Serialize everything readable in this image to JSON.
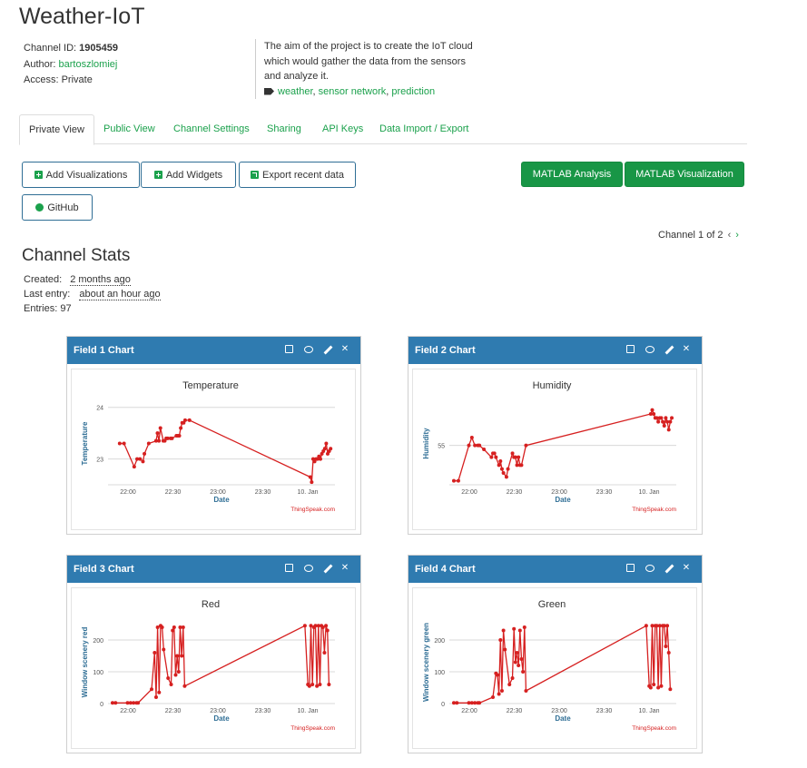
{
  "title": "Weather-IoT",
  "channel": {
    "id_label": "Channel ID:",
    "id_value": "1905459",
    "author_label": "Author:",
    "author_value": "bartoszlomiej",
    "access_label": "Access:",
    "access_value": "Private",
    "description": "The aim of the project is to create the IoT cloud which would gather the data from the sensors and analyze it.",
    "tags": [
      "weather",
      "sensor network",
      "prediction"
    ]
  },
  "tabs": [
    "Private View",
    "Public View",
    "Channel Settings",
    "Sharing",
    "API Keys",
    "Data Import / Export"
  ],
  "buttons": {
    "add_visualizations": "Add Visualizations",
    "add_widgets": "Add Widgets",
    "export": "Export recent data",
    "github": "GitHub",
    "matlab_analysis": "MATLAB Analysis",
    "matlab_visualization": "MATLAB Visualization"
  },
  "pager": {
    "label": "Channel 1 of 2",
    "prev": "‹",
    "next": "›"
  },
  "stats": {
    "title": "Channel Stats",
    "created_label": "Created:",
    "created_value": "2 months ago",
    "last_label": "Last entry:",
    "last_value": "about an hour ago",
    "entries_label": "Entries:",
    "entries_value": "97"
  },
  "colors": {
    "accent": "#1ba14c",
    "panel_header": "#2f7bb0",
    "series": "#d62020",
    "matlab": "#189646"
  },
  "panels": [
    {
      "header": "Field 1 Chart"
    },
    {
      "header": "Field 2 Chart"
    },
    {
      "header": "Field 3 Chart"
    },
    {
      "header": "Field 4 Chart"
    }
  ],
  "credit": "ThingSpeak.com",
  "chart_data": [
    {
      "type": "line",
      "title": "Temperature",
      "xlabel": "Date",
      "ylabel": "Temperature",
      "xticks": [
        "22:00",
        "22:30",
        "23:00",
        "23:30",
        "10. Jan"
      ],
      "yticks": [
        23,
        24
      ],
      "ylim": [
        22.5,
        24.1
      ],
      "x": [
        0,
        3,
        10,
        12,
        14,
        16,
        17,
        20,
        25,
        26,
        27,
        28,
        30,
        31,
        32,
        33,
        35,
        36,
        39,
        40,
        41,
        42,
        43,
        44,
        45,
        48,
        131,
        132,
        133,
        134,
        135,
        136,
        137,
        138,
        139,
        140,
        141,
        142,
        143,
        144,
        145
      ],
      "values": [
        23.3,
        23.3,
        22.85,
        23.0,
        23.0,
        22.95,
        23.1,
        23.3,
        23.35,
        23.5,
        23.35,
        23.6,
        23.35,
        23.35,
        23.4,
        23.4,
        23.4,
        23.4,
        23.45,
        23.45,
        23.45,
        23.6,
        23.7,
        23.7,
        23.75,
        23.75,
        22.65,
        22.55,
        23.0,
        22.95,
        23.0,
        23.0,
        23.05,
        23.0,
        23.1,
        23.15,
        23.2,
        23.3,
        23.1,
        23.15,
        23.2
      ],
      "ylabel_extra": "",
      "xlim": [
        -8,
        148
      ]
    },
    {
      "type": "line",
      "title": "Humidity",
      "xlabel": "Date",
      "ylabel": "Humidity",
      "xticks": [
        "22:00",
        "22:30",
        "23:00",
        "23:30",
        "10. Jan"
      ],
      "yticks": [
        55
      ],
      "ylim": [
        45,
        66
      ],
      "x": [
        0,
        3,
        10,
        12,
        14,
        16,
        17,
        20,
        25,
        26,
        27,
        28,
        30,
        31,
        32,
        33,
        35,
        36,
        39,
        40,
        41,
        42,
        43,
        44,
        45,
        48,
        131,
        132,
        133,
        134,
        135,
        136,
        137,
        138,
        139,
        140,
        141,
        142,
        143,
        144,
        145
      ],
      "values": [
        46,
        46,
        55,
        57,
        55,
        55,
        55,
        54,
        52,
        53,
        53,
        52,
        50,
        51,
        49,
        48,
        47,
        49,
        53,
        52,
        52,
        50,
        52,
        50,
        50,
        55,
        63,
        64,
        63,
        62,
        62,
        61,
        62,
        62,
        61,
        60,
        62,
        61,
        59,
        61,
        62
      ],
      "xlim": [
        -3,
        148
      ]
    },
    {
      "type": "line",
      "title": "Red",
      "xlabel": "Date",
      "ylabel": "Window scenery red",
      "xticks": [
        "22:00",
        "22:30",
        "23:00",
        "23:30",
        "10. Jan"
      ],
      "yticks": [
        0,
        100,
        200
      ],
      "ylim": [
        0,
        260
      ],
      "x": [
        0,
        2,
        10,
        12,
        14,
        16,
        17,
        26,
        28,
        29,
        30,
        31,
        32,
        33,
        34,
        37,
        39,
        40,
        41,
        42,
        43,
        44,
        45,
        46,
        47,
        48,
        128,
        130,
        131,
        132,
        133,
        134,
        135,
        136,
        137,
        138,
        139,
        140,
        141,
        142,
        143,
        144
      ],
      "values": [
        2,
        2,
        2,
        2,
        2,
        2,
        2,
        45,
        160,
        20,
        240,
        35,
        245,
        240,
        170,
        80,
        60,
        230,
        240,
        90,
        150,
        100,
        240,
        150,
        240,
        55,
        245,
        60,
        55,
        245,
        60,
        240,
        245,
        55,
        245,
        60,
        245,
        240,
        160,
        245,
        230,
        60
      ],
      "xlim": [
        -3,
        148
      ]
    },
    {
      "type": "line",
      "title": "Green",
      "xlabel": "Date",
      "ylabel": "Window scenery green",
      "xticks": [
        "22:00",
        "22:30",
        "23:00",
        "23:30",
        "10. Jan"
      ],
      "yticks": [
        0,
        100,
        200
      ],
      "ylim": [
        0,
        260
      ],
      "x": [
        0,
        2,
        10,
        12,
        14,
        16,
        17,
        26,
        28,
        29,
        30,
        31,
        32,
        33,
        34,
        37,
        39,
        40,
        41,
        42,
        43,
        44,
        45,
        46,
        47,
        48,
        128,
        130,
        131,
        132,
        133,
        134,
        135,
        136,
        137,
        138,
        139,
        140,
        141,
        142,
        143,
        144
      ],
      "values": [
        2,
        2,
        2,
        2,
        2,
        2,
        2,
        20,
        95,
        90,
        30,
        200,
        40,
        230,
        170,
        60,
        80,
        235,
        130,
        160,
        120,
        230,
        140,
        100,
        240,
        40,
        245,
        55,
        50,
        245,
        60,
        245,
        245,
        50,
        245,
        55,
        245,
        245,
        180,
        245,
        160,
        45
      ],
      "xlim": [
        -3,
        148
      ]
    }
  ]
}
